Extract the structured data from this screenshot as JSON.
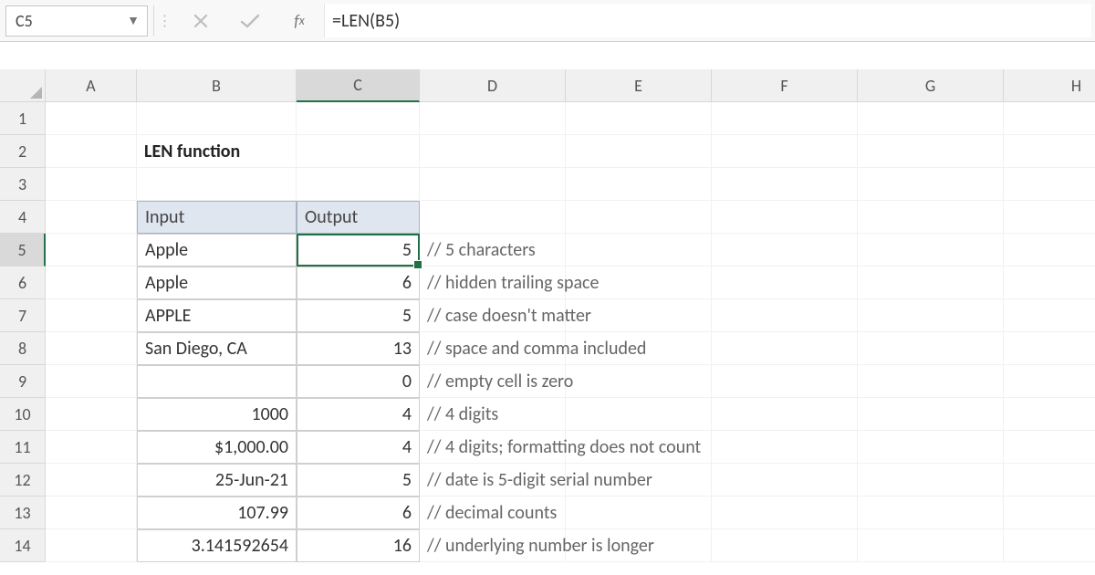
{
  "namebox": {
    "value": "C5"
  },
  "formula": {
    "value": "=LEN(B5)"
  },
  "fx": {
    "f": "f",
    "x": "x"
  },
  "columns": [
    "A",
    "B",
    "C",
    "D",
    "E",
    "F",
    "G",
    "H"
  ],
  "rows": [
    "1",
    "2",
    "3",
    "4",
    "5",
    "6",
    "7",
    "8",
    "9",
    "10",
    "11",
    "12",
    "13",
    "14"
  ],
  "title": "LEN function",
  "table": {
    "headers": {
      "input": "Input",
      "output": "Output"
    },
    "rows": [
      {
        "input": "Apple",
        "output": "5",
        "comment": "// 5 characters"
      },
      {
        "input": "Apple",
        "output": "6",
        "comment": "// hidden trailing space"
      },
      {
        "input": "APPLE",
        "output": "5",
        "comment": "// case doesn't matter"
      },
      {
        "input": "San Diego, CA",
        "output": "13",
        "comment": "// space and comma included"
      },
      {
        "input": "",
        "output": "0",
        "comment": "// empty cell is zero"
      },
      {
        "input": "1000",
        "output": "4",
        "comment": "// 4 digits"
      },
      {
        "input": "$1,000.00",
        "output": "4",
        "comment": "// 4 digits; formatting does not count"
      },
      {
        "input": "25-Jun-21",
        "output": "5",
        "comment": "// date is 5-digit serial number"
      },
      {
        "input": "107.99",
        "output": "6",
        "comment": "// decimal counts"
      },
      {
        "input": "3.141592654",
        "output": "16",
        "comment": "// underlying number is longer"
      }
    ]
  }
}
